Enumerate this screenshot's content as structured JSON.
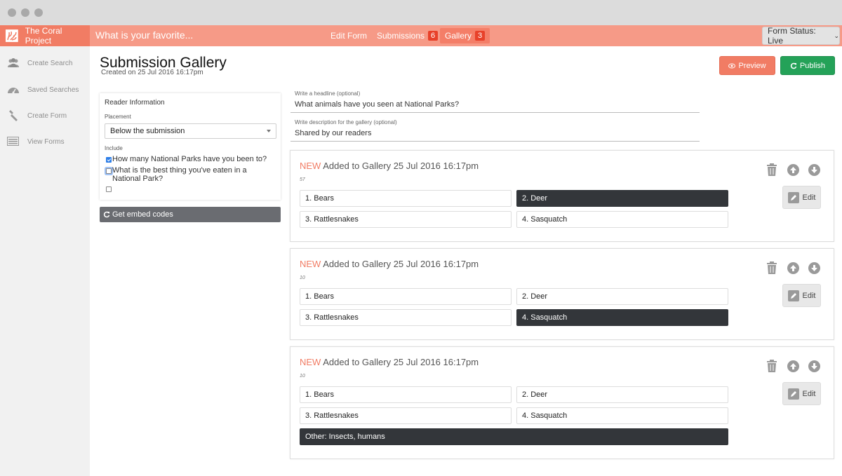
{
  "app": {
    "brand": "The Coral Project",
    "form_title": "What is your favorite..."
  },
  "nav": {
    "edit_form": "Edit Form",
    "submissions": "Submissions",
    "submissions_count": "6",
    "gallery": "Gallery",
    "gallery_count": "3",
    "form_status": "Form Status: Live"
  },
  "sidebar": {
    "items": [
      {
        "label": "Create Search",
        "icon": "users-icon"
      },
      {
        "label": "Saved Searches",
        "icon": "dashboard-icon"
      },
      {
        "label": "Create Form",
        "icon": "wrench-icon"
      },
      {
        "label": "View Forms",
        "icon": "list-icon"
      }
    ]
  },
  "page": {
    "title": "Submission Gallery",
    "created": "Created on 25 Jul 2016 16:17pm",
    "preview_label": "Preview",
    "publish_label": "Publish"
  },
  "reader_info": {
    "heading": "Reader Information",
    "placement_label": "Placement",
    "placement_value": "Below the submission",
    "include_label": "Include",
    "options": [
      {
        "label": "How many National Parks have you been to?",
        "checked": true
      },
      {
        "label": "What is the best thing you've eaten in a National Park?",
        "checked": false
      },
      {
        "label": "",
        "checked": false
      }
    ],
    "embed_label": "Get embed codes"
  },
  "gallery_meta": {
    "headline_label": "Write a headline (optional)",
    "headline_value": "What animals have you seen at National Parks?",
    "description_label": "Write description for the gallery (optional)",
    "description_value": "Shared by our readers"
  },
  "submissions": [
    {
      "new_label": "NEW",
      "header": "Added to Gallery 25 Jul 2016 16:17pm",
      "count": "57",
      "answers": [
        "1. Bears",
        "2. Deer",
        "3. Rattlesnakes",
        "4. Sasquatch"
      ],
      "selected": 1,
      "other": "",
      "edit_label": "Edit"
    },
    {
      "new_label": "NEW",
      "header": "Added to Gallery 25 Jul 2016 16:17pm",
      "count": "10",
      "answers": [
        "1. Bears",
        "2. Deer",
        "3. Rattlesnakes",
        "4. Sasquatch"
      ],
      "selected": 3,
      "other": "",
      "edit_label": "Edit"
    },
    {
      "new_label": "NEW",
      "header": "Added to Gallery 25 Jul 2016 16:17pm",
      "count": "10",
      "answers": [
        "1. Bears",
        "2. Deer",
        "3. Rattlesnakes",
        "4. Sasquatch"
      ],
      "selected": -1,
      "other": "Other: Insects, humans",
      "edit_label": "Edit"
    }
  ],
  "colors": {
    "topbar": "#f69a87",
    "brand": "#f17c64",
    "publish": "#24a258",
    "selected_answer": "#33363a"
  }
}
